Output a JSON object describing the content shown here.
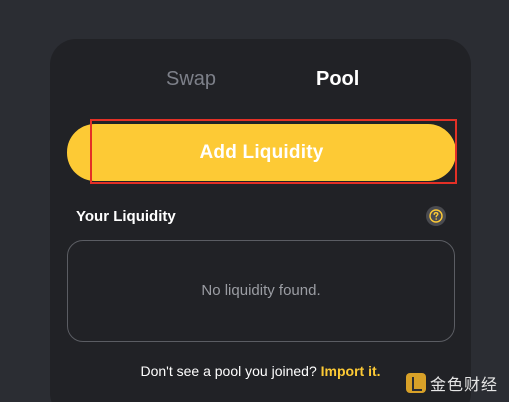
{
  "tabs": {
    "swap": "Swap",
    "pool": "Pool"
  },
  "actions": {
    "add_liquidity": "Add Liquidity"
  },
  "your_liquidity": {
    "title": "Your Liquidity",
    "empty_message": "No liquidity found."
  },
  "footer": {
    "prompt": "Don't see a pool you joined? ",
    "import_link": "Import it."
  },
  "watermark": {
    "text": "金色财经"
  },
  "colors": {
    "accent": "#fdca35",
    "background": "#2b2d33",
    "card": "#212226",
    "highlight": "#e33026"
  },
  "icons": {
    "help": "question-mark-circle-icon",
    "logo": "jinse-logo-icon"
  }
}
